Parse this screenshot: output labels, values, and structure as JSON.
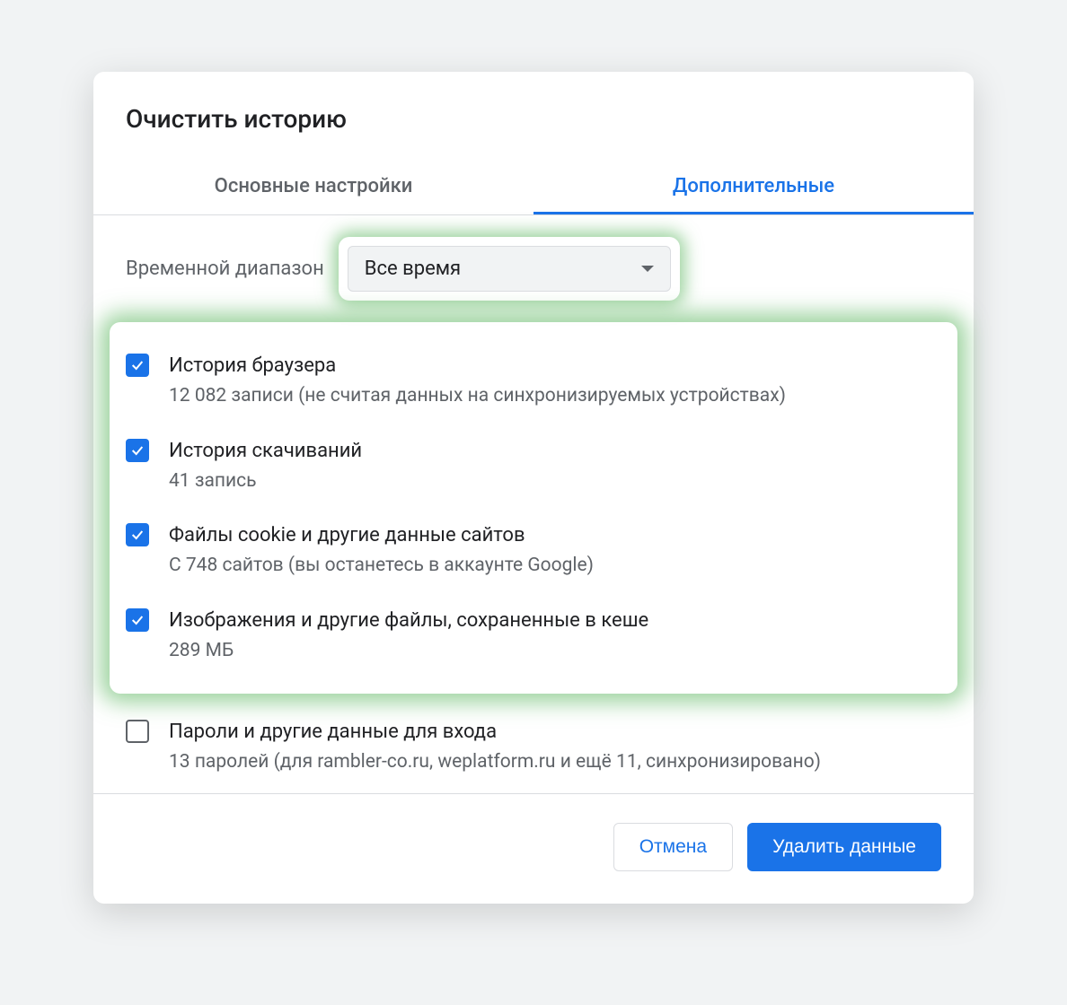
{
  "dialog": {
    "title": "Очистить историю"
  },
  "tabs": {
    "basic": "Основные настройки",
    "advanced": "Дополнительные"
  },
  "range": {
    "label": "Временной диапазон",
    "value": "Все время"
  },
  "options": [
    {
      "checked": true,
      "title": "История браузера",
      "subtitle": "12 082 записи (не считая данных на синхронизируемых устройствах)"
    },
    {
      "checked": true,
      "title": "История скачиваний",
      "subtitle": "41 запись"
    },
    {
      "checked": true,
      "title": "Файлы cookie и другие данные сайтов",
      "subtitle": "С 748 сайтов (вы останетесь в аккаунте Google)"
    },
    {
      "checked": true,
      "title": "Изображения и другие файлы, сохраненные в кеше",
      "subtitle": "289 МБ"
    }
  ],
  "extra_option": {
    "checked": false,
    "title": "Пароли и другие данные для входа",
    "subtitle": "13 паролей (для rambler-co.ru, weplatform.ru и ещё 11, синхронизировано)"
  },
  "buttons": {
    "cancel": "Отмена",
    "confirm": "Удалить данные"
  }
}
